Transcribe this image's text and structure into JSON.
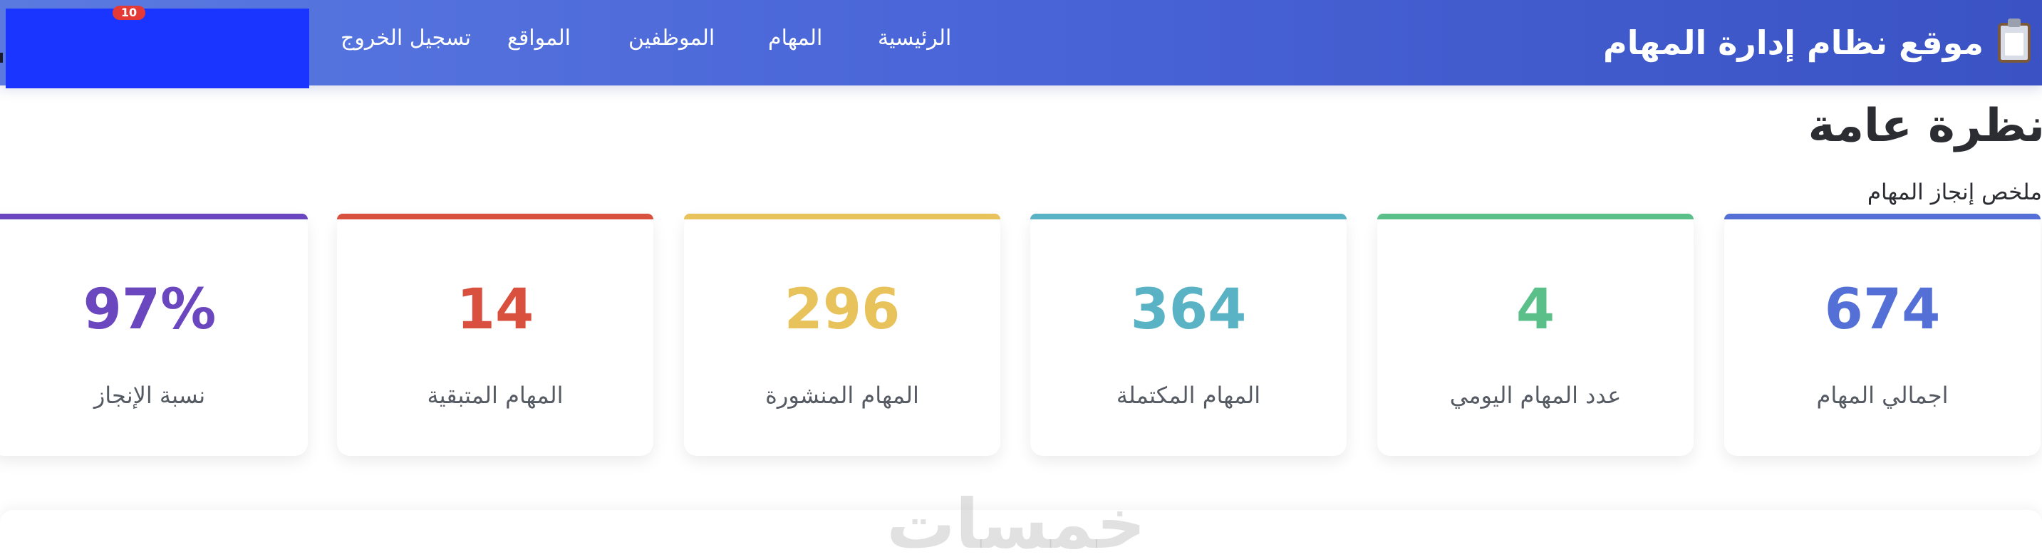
{
  "header": {
    "brand_title": "موقع نظام إدارة المهام",
    "brand_icon": "clipboard-icon",
    "nav": [
      {
        "id": "home",
        "label": "الرئيسية"
      },
      {
        "id": "tasks",
        "label": "المهام"
      },
      {
        "id": "employees",
        "label": "الموظفين"
      },
      {
        "id": "sites",
        "label": "المواقع"
      },
      {
        "id": "logout",
        "label": "تسجيل الخروج"
      }
    ],
    "notification_count": "10",
    "colors": {
      "gradient_start": "#5b7ae0",
      "gradient_end": "#3a52c4",
      "user_box": "#1a35ff"
    }
  },
  "overview": {
    "title": "نظرة عامة",
    "subtitle": "ملخص إنجاز المهام"
  },
  "cards": [
    {
      "value": "674",
      "label": "اجمالي المهام",
      "color": "#5470d6"
    },
    {
      "value": "4",
      "label": "عدد المهام اليومي",
      "color": "#5bbf8a"
    },
    {
      "value": "364",
      "label": "المهام المكتملة",
      "color": "#5ab3c4"
    },
    {
      "value": "296",
      "label": "المهام المنشورة",
      "color": "#e8c25a"
    },
    {
      "value": "14",
      "label": "المهام المتبقية",
      "color": "#d9503f"
    },
    {
      "value": "97%",
      "label": "نسبة الإنجاز",
      "color": "#6a46bf"
    }
  ],
  "watermark": "خمسات"
}
